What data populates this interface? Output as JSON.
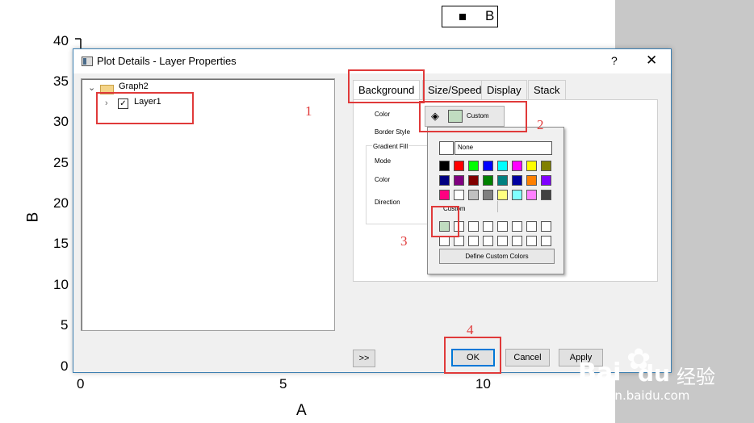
{
  "plot": {
    "y_ticks": [
      "40",
      "35",
      "30",
      "25",
      "20",
      "15",
      "10",
      "5",
      "0"
    ],
    "x_ticks": [
      "0",
      "5",
      "10"
    ],
    "y_label": "B",
    "x_label": "A",
    "legend_label": "B"
  },
  "dialog": {
    "title": "Plot Details - Layer Properties",
    "help": "?",
    "close": "✕",
    "tree": {
      "graph": "Graph2",
      "layer": "Layer1",
      "layer_checked": "✓"
    },
    "tabs": [
      "Background",
      "Size/Speed",
      "Display",
      "Stack"
    ],
    "props": {
      "color": "Color",
      "border_style": "Border Style",
      "gradient_fill": "Gradient Fill",
      "mode": "Mode",
      "color2": "Color",
      "direction": "Direction"
    },
    "color_button": {
      "label": "Custom",
      "swatch": "#c0dcc0"
    },
    "color_popup": {
      "none_label": "None",
      "custom_label": "Custom",
      "define_label": "Define Custom Colors",
      "palette": [
        [
          "#000000",
          "#ff0000",
          "#00ff00",
          "#0000ff",
          "#00ffff",
          "#ff00ff",
          "#ffff00",
          "#808000"
        ],
        [
          "#000080",
          "#800080",
          "#800000",
          "#008000",
          "#008080",
          "#0000a0",
          "#ff8000",
          "#8000ff"
        ],
        [
          "#ff0080",
          "#ffffff",
          "#c0c0c0",
          "#808080",
          "#ffff80",
          "#80ffff",
          "#ff80ff",
          "#404040"
        ]
      ],
      "custom_first": "#c0dcc0"
    },
    "buttons": {
      "more": ">>",
      "ok": "OK",
      "cancel": "Cancel",
      "apply": "Apply"
    }
  },
  "annotations": {
    "marker1": "1",
    "marker2": "2",
    "marker3": "3",
    "marker4": "4",
    "color": "#e03a3a"
  },
  "watermark": {
    "brand": "Bai",
    "brand2": "du",
    "cn": "经验",
    "url": "jingyan.baidu.com"
  }
}
